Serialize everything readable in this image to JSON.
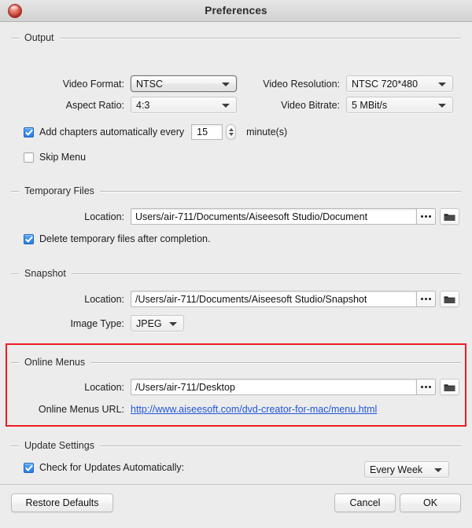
{
  "window": {
    "title": "Preferences",
    "close_icon": "close-icon"
  },
  "groups": {
    "output": {
      "title": "Output",
      "video_format_label": "Video Format:",
      "video_format_value": "NTSC",
      "video_resolution_label": "Video Resolution:",
      "video_resolution_value": "NTSC 720*480",
      "aspect_ratio_label": "Aspect Ratio:",
      "aspect_ratio_value": "4:3",
      "video_bitrate_label": "Video Bitrate:",
      "video_bitrate_value": "5 MBit/s",
      "add_chapters_label": "Add chapters automatically every",
      "add_chapters_checked": true,
      "chapter_interval_value": "15",
      "minutes_label": "minute(s)",
      "skip_menu_label": "Skip Menu",
      "skip_menu_checked": false
    },
    "temporary_files": {
      "title": "Temporary Files",
      "location_label": "Location:",
      "location_value": "Users/air-711/Documents/Aiseesoft Studio/Document",
      "delete_temp_label": "Delete temporary files after completion.",
      "delete_temp_checked": true,
      "browse_icon": "ellipsis-icon",
      "folder_icon": "folder-icon"
    },
    "snapshot": {
      "title": "Snapshot",
      "location_label": "Location:",
      "location_value": "/Users/air-711/Documents/Aiseesoft Studio/Snapshot",
      "image_type_label": "Image Type:",
      "image_type_value": "JPEG",
      "browse_icon": "ellipsis-icon",
      "folder_icon": "folder-icon"
    },
    "online_menus": {
      "title": "Online Menus",
      "location_label": "Location:",
      "location_value": "/Users/air-711/Desktop",
      "url_label": "Online Menus URL:",
      "url_value": "http://www.aiseesoft.com/dvd-creator-for-mac/menu.html",
      "browse_icon": "ellipsis-icon",
      "folder_icon": "folder-icon",
      "highlight_color": "#ed1c24"
    },
    "update_settings": {
      "title": "Update Settings",
      "check_updates_label": "Check for Updates Automatically:",
      "check_updates_checked": true,
      "frequency_value": "Every Week"
    }
  },
  "footer": {
    "restore_defaults_label": "Restore Defaults",
    "cancel_label": "Cancel",
    "ok_label": "OK"
  }
}
